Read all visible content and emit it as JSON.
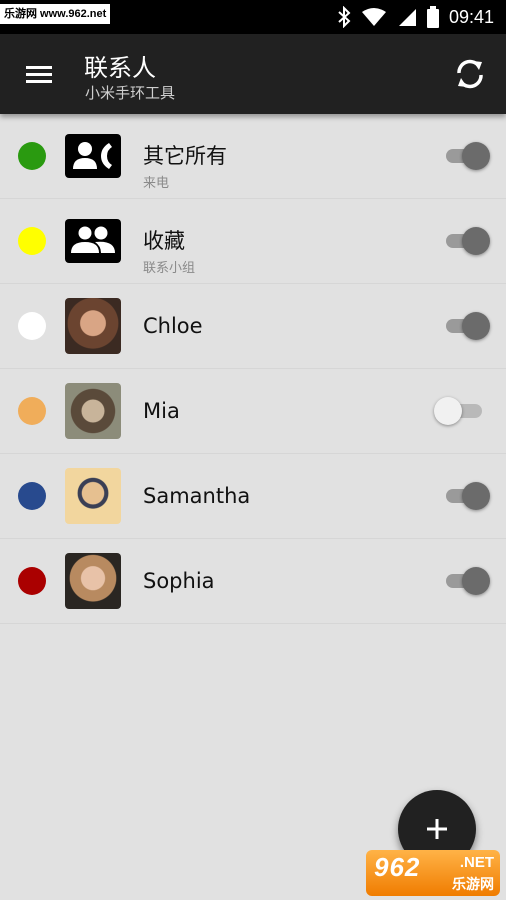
{
  "status_bar": {
    "watermark_text": "乐游网 www.962.net",
    "time": "09:41",
    "icons": [
      "bluetooth-icon",
      "wifi-icon",
      "signal-icon",
      "battery-icon"
    ]
  },
  "app_bar": {
    "title": "联系人",
    "subtitle": "小米手环工具",
    "menu_icon": "menu-icon",
    "sync_icon": "sync-icon"
  },
  "contacts": [
    {
      "name": "其它所有",
      "sub": "来电",
      "dot_color": "#2a9a10",
      "avatar": "incoming-call-group-icon",
      "enabled": true
    },
    {
      "name": "收藏",
      "sub": "联系小组",
      "dot_color": "#ffff00",
      "avatar": "group-icon",
      "enabled": true
    },
    {
      "name": "Chloe",
      "sub": "",
      "dot_color": "#ffffff",
      "avatar": "photo",
      "enabled": true
    },
    {
      "name": "Mia",
      "sub": "",
      "dot_color": "#f0ad5a",
      "avatar": "photo",
      "enabled": false
    },
    {
      "name": "Samantha",
      "sub": "",
      "dot_color": "#284a8e",
      "avatar": "photo",
      "enabled": true
    },
    {
      "name": "Sophia",
      "sub": "",
      "dot_color": "#aa0000",
      "avatar": "photo",
      "enabled": true
    }
  ],
  "fab": {
    "icon": "plus-icon"
  },
  "watermark": {
    "logo_number": "962",
    "logo_domain": ".NET",
    "logo_brand": "乐游网"
  },
  "colors": {
    "app_bar": "#212121",
    "background": "#e1e1e1",
    "switch_on": "#6b6b6b"
  }
}
